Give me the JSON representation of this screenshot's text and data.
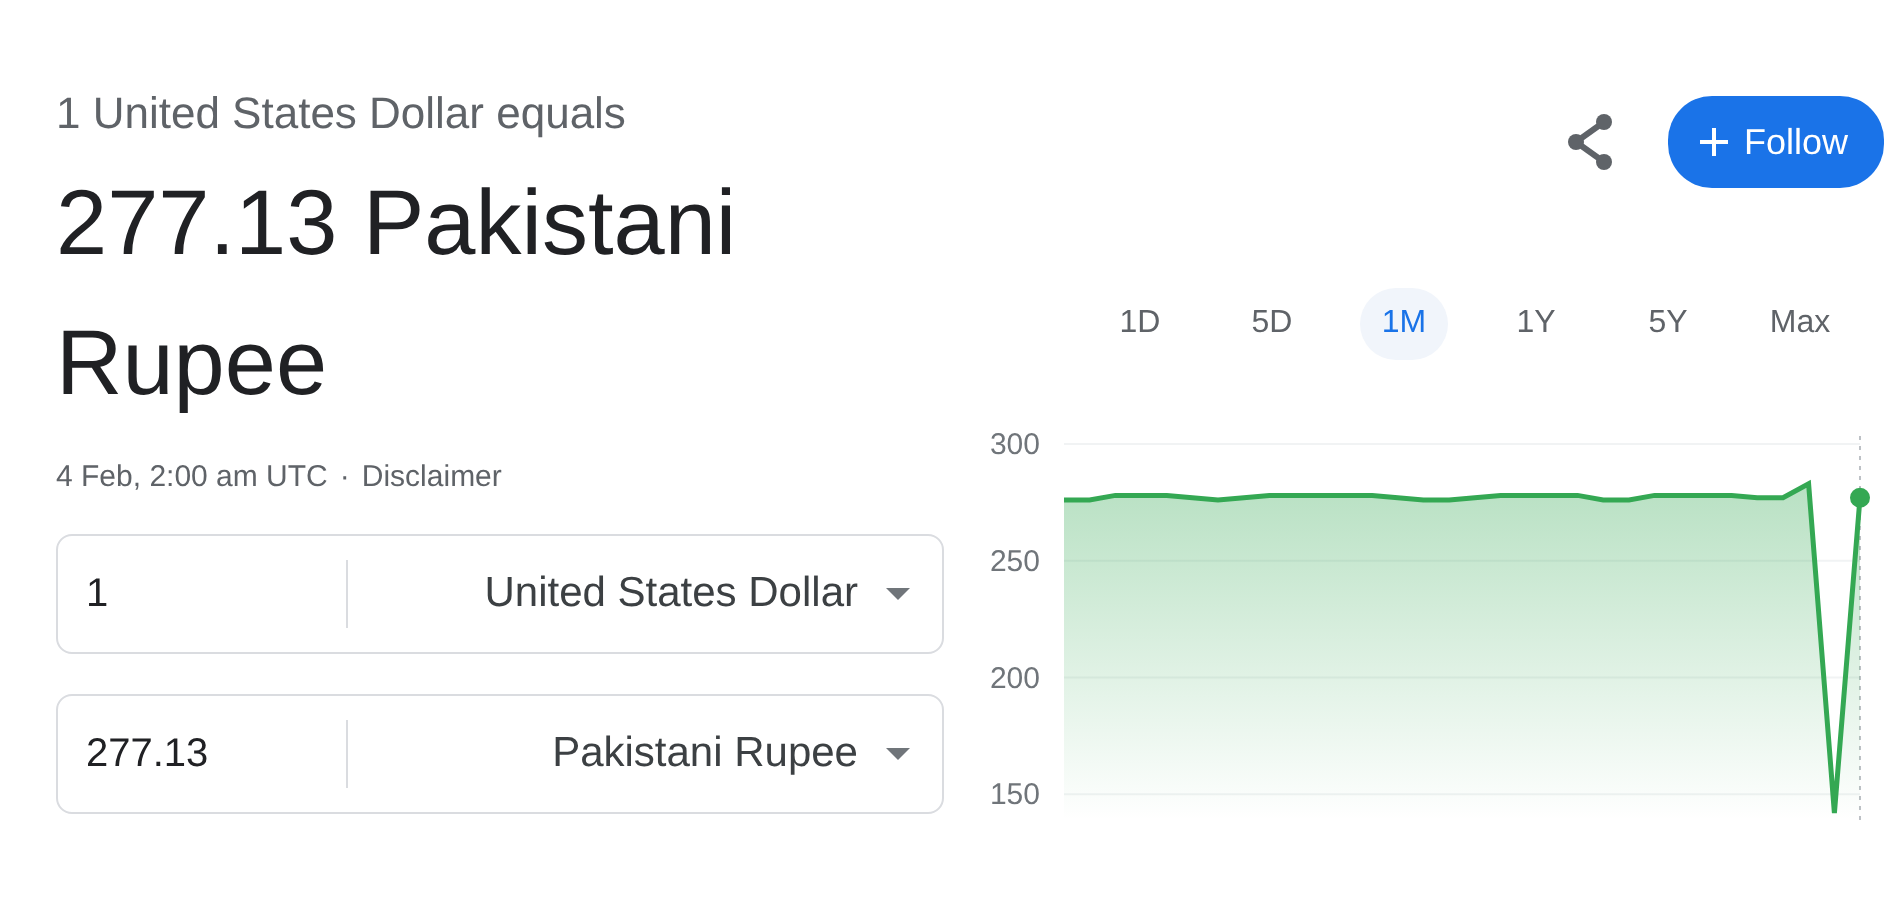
{
  "headline": "1 United States Dollar equals",
  "result": "277.13 Pakistani Rupee",
  "timestamp": "4 Feb, 2:00 am UTC",
  "separator": "·",
  "disclaimer": "Disclaimer",
  "follow_button": "Follow",
  "converter": [
    {
      "amount": "1",
      "currency": "United States Dollar"
    },
    {
      "amount": "277.13",
      "currency": "Pakistani Rupee"
    }
  ],
  "ranges": [
    {
      "label": "1D",
      "selected": false
    },
    {
      "label": "5D",
      "selected": false
    },
    {
      "label": "1M",
      "selected": true
    },
    {
      "label": "1Y",
      "selected": false
    },
    {
      "label": "5Y",
      "selected": false
    },
    {
      "label": "Max",
      "selected": false
    }
  ],
  "chart": {
    "chart_data": {
      "type": "area",
      "ylim": [
        139,
        300
      ],
      "grid": true,
      "yticks": [
        150,
        200,
        250,
        300
      ],
      "series": [
        {
          "color": "#34a853",
          "values": [
            276,
            276,
            278,
            278,
            278,
            277,
            276,
            277,
            278,
            278,
            278,
            278,
            278,
            277,
            276,
            276,
            277,
            278,
            278,
            278,
            278,
            276,
            276,
            278,
            278,
            278,
            278,
            277,
            277,
            283,
            142,
            277
          ]
        }
      ]
    }
  }
}
